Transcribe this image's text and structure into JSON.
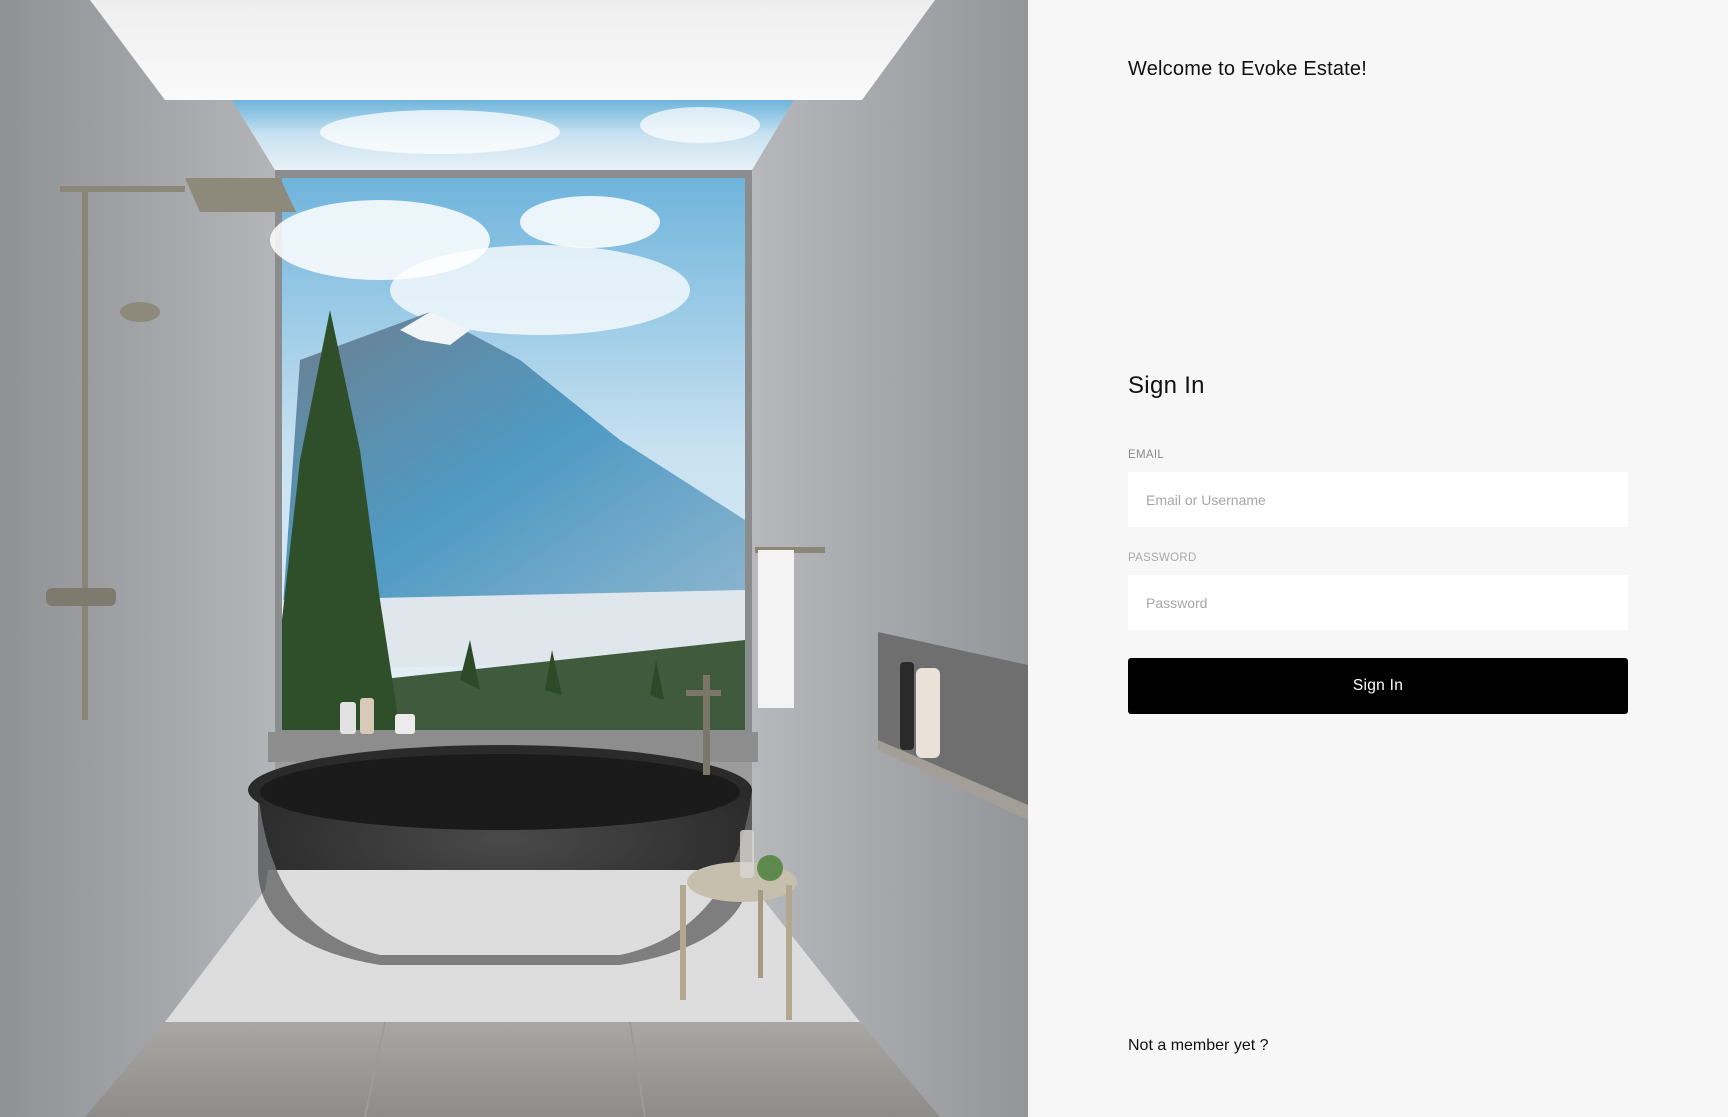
{
  "welcome": {
    "title": "Welcome to Evoke Estate!"
  },
  "form": {
    "heading": "Sign In",
    "email": {
      "label": "EMAIL",
      "placeholder": "Email or Username",
      "value": ""
    },
    "password": {
      "label": "PASSWORD",
      "placeholder": "Password",
      "value": ""
    },
    "submit_label": "Sign In"
  },
  "footer": {
    "register_prompt": "Not a member yet ?"
  },
  "hero": {
    "image": "bathroom-with-mountain-view-illustration"
  },
  "colors": {
    "panel_bg": "#f7f7f7",
    "button_bg": "#000000",
    "button_text": "#ffffff",
    "input_bg": "#ffffff"
  }
}
